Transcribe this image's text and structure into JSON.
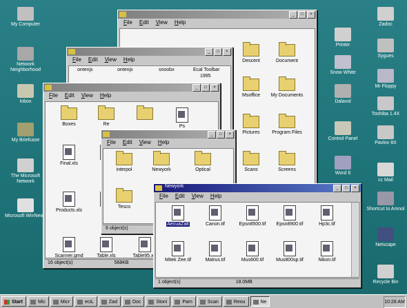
{
  "desktop": {
    "left_icons": [
      "My Computer",
      "Network Neighborhood",
      "Inbox",
      "My Briefcase",
      "The Microsoft Network",
      "Microsoft WinNews"
    ],
    "mid_icons": [
      "Printer",
      "Snow White",
      "Dalavol",
      "Control Panel",
      "Word 6"
    ],
    "right_icons": [
      "Zadoc",
      "Sygues",
      "Mr Floppy",
      "Toshiba 1.4X",
      "Pavlov 8X",
      "cc Mail",
      "Shortcut to Amnol",
      "Netscape",
      "Recycle Bin"
    ]
  },
  "menu": {
    "file": "File",
    "edit": "Edit",
    "view": "View",
    "help": "Help"
  },
  "win_back": {
    "items": [
      "Descent",
      "Document",
      "Msoffice",
      "My Documents",
      "Pictures",
      "Program Files",
      "Scans",
      "Screens"
    ]
  },
  "win_second": {
    "row": [
      "ontenjs",
      "ontenjs",
      "snoobx",
      "Ecal Toolbar"
    ],
    "year": "1995"
  },
  "win_third": {
    "folders": [
      "Boxes",
      "Re",
      "",
      "Ps"
    ],
    "files": [
      "Final.xls",
      "Lo",
      "Products.xls",
      "Re",
      "Scanner.gmd",
      "Table.xls",
      "Table95.xls"
    ],
    "status_count": "16 object(s)",
    "status_size": "568KB"
  },
  "win_fourth": {
    "folders": [
      "interpol",
      "Newyork",
      "Optical",
      "Tesco"
    ],
    "status_count": "6 object(s)"
  },
  "win_front": {
    "title": "Newyork",
    "row1": [
      "AecuaZalt",
      "Canon.tif",
      "Epsn8500.tif",
      "Epsn8900.tif",
      "Hp3c.tif"
    ],
    "row2": [
      "Mitek Zee.tif",
      "Matrus.tif",
      "Mus600.tif",
      "Mus800sp.tif",
      "Nikon.tif"
    ],
    "status_count": "1 object(s)",
    "status_size": "18.0MB"
  },
  "taskbar": {
    "start": "Start",
    "buttons": [
      "Mic",
      "Micr",
      "eciL",
      "Zad",
      "Doc",
      "Stoni",
      "Pam",
      "Scan",
      "Reou",
      "Ne"
    ],
    "clock": "10:28 AM"
  }
}
